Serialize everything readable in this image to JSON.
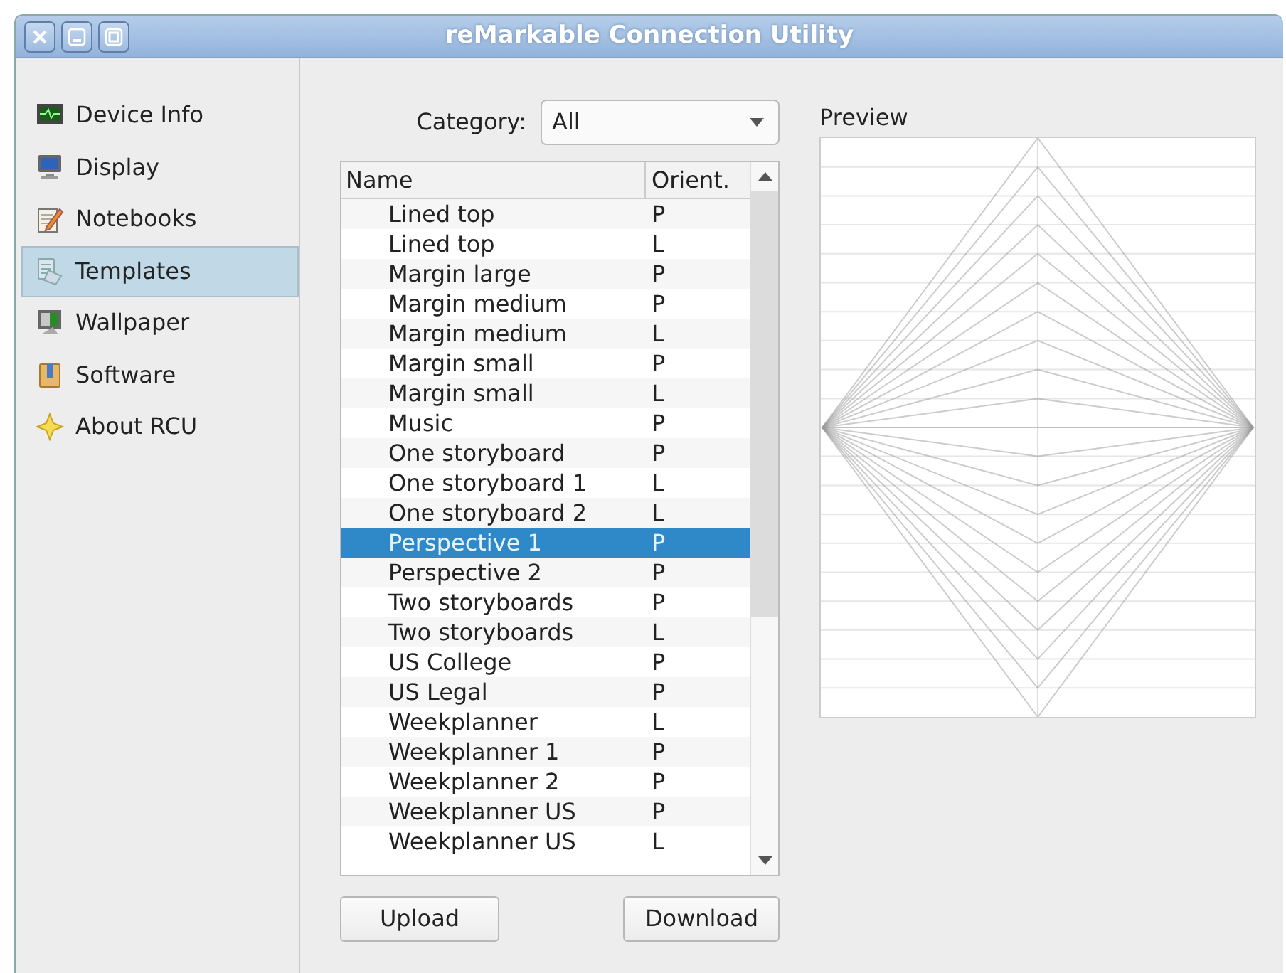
{
  "window": {
    "title": "reMarkable Connection Utility"
  },
  "sidebar": {
    "items": [
      {
        "label": "Device Info",
        "selected": false
      },
      {
        "label": "Display",
        "selected": false
      },
      {
        "label": "Notebooks",
        "selected": false
      },
      {
        "label": "Templates",
        "selected": true
      },
      {
        "label": "Wallpaper",
        "selected": false
      },
      {
        "label": "Software",
        "selected": false
      },
      {
        "label": "About RCU",
        "selected": false
      }
    ]
  },
  "category": {
    "label": "Category:",
    "value": "All"
  },
  "table": {
    "columns": [
      "Name",
      "Orient."
    ],
    "rows": [
      {
        "name": "Lined top",
        "orient": "P",
        "selected": false
      },
      {
        "name": "Lined top",
        "orient": "L",
        "selected": false
      },
      {
        "name": "Margin large",
        "orient": "P",
        "selected": false
      },
      {
        "name": "Margin medium",
        "orient": "P",
        "selected": false
      },
      {
        "name": "Margin medium",
        "orient": "L",
        "selected": false
      },
      {
        "name": "Margin small",
        "orient": "P",
        "selected": false
      },
      {
        "name": "Margin small",
        "orient": "L",
        "selected": false
      },
      {
        "name": "Music",
        "orient": "P",
        "selected": false
      },
      {
        "name": "One storyboard",
        "orient": "P",
        "selected": false
      },
      {
        "name": "One storyboard 1",
        "orient": "L",
        "selected": false
      },
      {
        "name": "One storyboard 2",
        "orient": "L",
        "selected": false
      },
      {
        "name": "Perspective 1",
        "orient": "P",
        "selected": true
      },
      {
        "name": "Perspective 2",
        "orient": "P",
        "selected": false
      },
      {
        "name": "Two storyboards",
        "orient": "P",
        "selected": false
      },
      {
        "name": "Two storyboards",
        "orient": "L",
        "selected": false
      },
      {
        "name": "US College",
        "orient": "P",
        "selected": false
      },
      {
        "name": "US Legal",
        "orient": "P",
        "selected": false
      },
      {
        "name": "Weekplanner",
        "orient": "L",
        "selected": false
      },
      {
        "name": "Weekplanner 1",
        "orient": "P",
        "selected": false
      },
      {
        "name": "Weekplanner 2",
        "orient": "P",
        "selected": false
      },
      {
        "name": "Weekplanner US",
        "orient": "P",
        "selected": false
      },
      {
        "name": "Weekplanner US",
        "orient": "L",
        "selected": false
      }
    ]
  },
  "buttons": [
    "Upload",
    "Download"
  ],
  "preview": {
    "label": "Preview"
  }
}
